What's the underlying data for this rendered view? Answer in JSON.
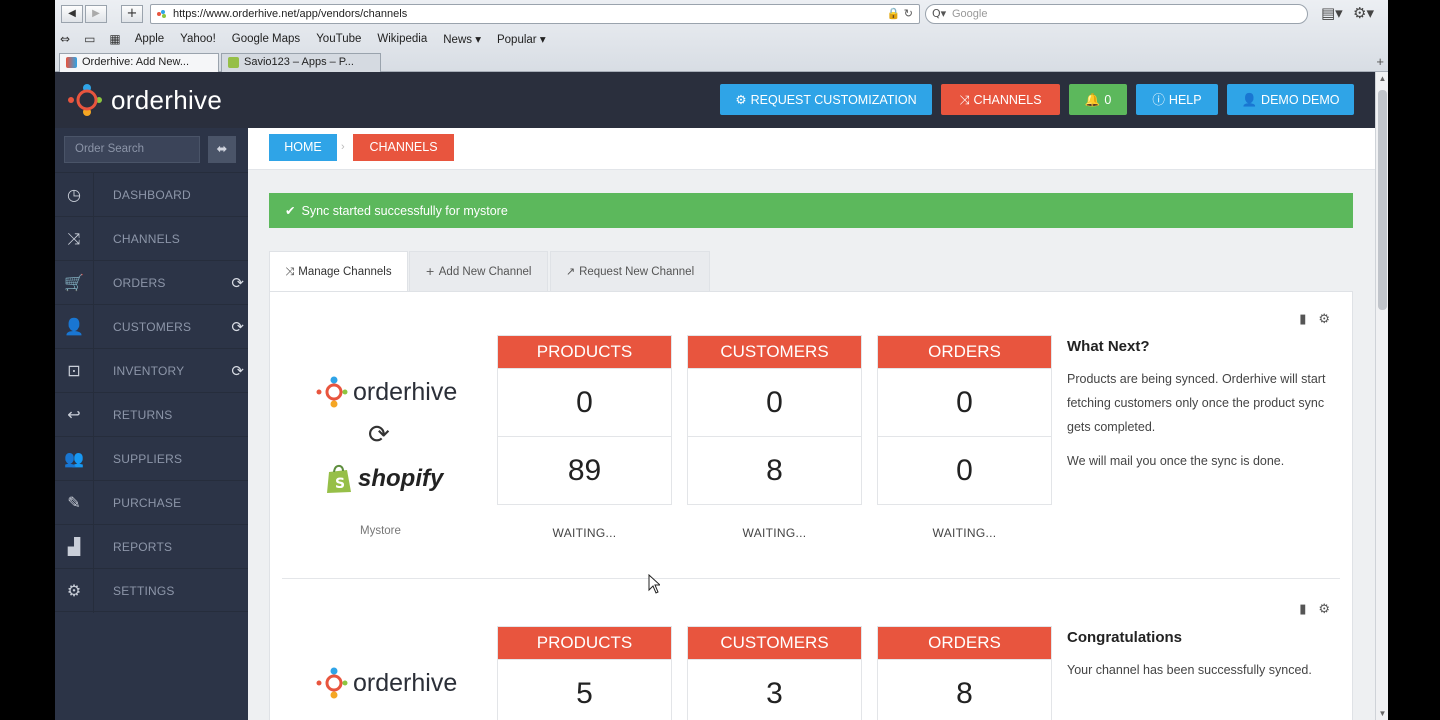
{
  "browser": {
    "url": "https://www.orderhive.net/app/vendors/channels",
    "search_placeholder": "Google",
    "bookmarks": [
      "Apple",
      "Yahoo!",
      "Google Maps",
      "YouTube",
      "Wikipedia",
      "News ▾",
      "Popular ▾"
    ],
    "tabs": [
      {
        "label": "Orderhive: Add New..."
      },
      {
        "label": "Savio123 – Apps – P..."
      }
    ]
  },
  "app": {
    "brand": "orderhive",
    "header_buttons": {
      "request": "REQUEST CUSTOMIZATION",
      "channels": "CHANNELS",
      "notifications": "0",
      "help": "HELP",
      "user": "DEMO DEMO"
    },
    "colors": {
      "blue": "#2fa4e7",
      "red": "#e8553e",
      "green": "#5cb85c",
      "header": "#2a2f3d",
      "sidebar": "#2c3447"
    }
  },
  "sidebar": {
    "search_placeholder": "Order Search",
    "items": [
      {
        "label": "DASHBOARD",
        "icon": "dashboard-icon"
      },
      {
        "label": "CHANNELS",
        "icon": "shuffle-icon"
      },
      {
        "label": "ORDERS",
        "icon": "cart-icon"
      },
      {
        "label": "CUSTOMERS",
        "icon": "user-icon"
      },
      {
        "label": "INVENTORY",
        "icon": "inventory-icon"
      },
      {
        "label": "RETURNS",
        "icon": "reply-icon"
      },
      {
        "label": "SUPPLIERS",
        "icon": "group-icon"
      },
      {
        "label": "PURCHASE",
        "icon": "edit-icon"
      },
      {
        "label": "REPORTS",
        "icon": "bar-chart-icon"
      },
      {
        "label": "SETTINGS",
        "icon": "gear-icon"
      }
    ]
  },
  "breadcrumb": {
    "home": "HOME",
    "current": "CHANNELS"
  },
  "alert": {
    "message": "Sync started successfully for mystore"
  },
  "tabs": {
    "manage": "Manage Channels",
    "add": "Add New Channel",
    "request": "Request New Channel"
  },
  "channels": [
    {
      "brand": "orderhive",
      "platform": "shopify",
      "store": "Mystore",
      "stats": {
        "products": {
          "label": "PRODUCTS",
          "top": "0",
          "bottom": "89",
          "status": "WAITING..."
        },
        "customers": {
          "label": "CUSTOMERS",
          "top": "0",
          "bottom": "8",
          "status": "WAITING..."
        },
        "orders": {
          "label": "ORDERS",
          "top": "0",
          "bottom": "0",
          "status": "WAITING..."
        }
      },
      "info_title": "What Next?",
      "info_p1": "Products are being synced. Orderhive will start fetching customers only once the product sync gets completed.",
      "info_p2": "We will mail you once the sync is done."
    },
    {
      "brand": "orderhive",
      "stats": {
        "products": {
          "label": "PRODUCTS",
          "top": "5"
        },
        "customers": {
          "label": "CUSTOMERS",
          "top": "3"
        },
        "orders": {
          "label": "ORDERS",
          "top": "8"
        }
      },
      "info_title": "Congratulations",
      "info_p1": "Your channel has been successfully synced."
    }
  ]
}
